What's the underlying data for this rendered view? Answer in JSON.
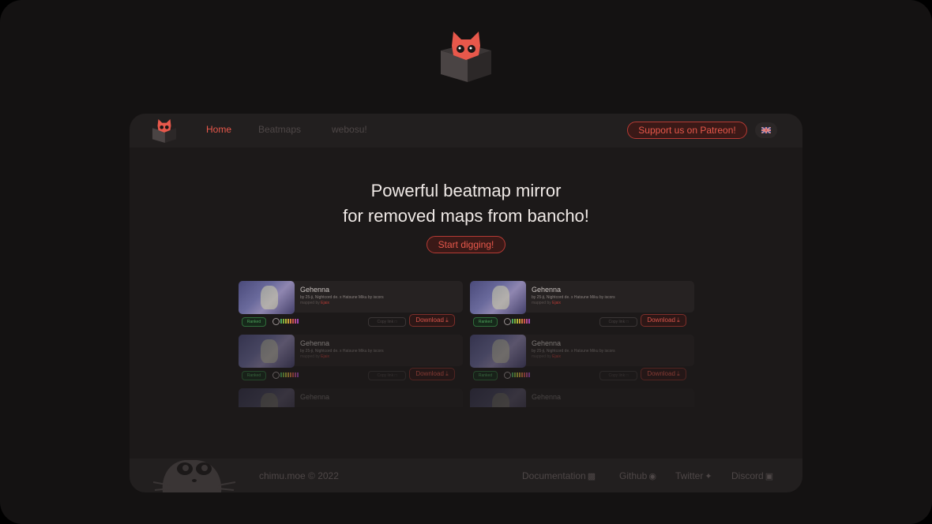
{
  "nav": {
    "links": [
      "Home",
      "Beatmaps",
      "webosu!"
    ],
    "patreon": "Support us on Patreon!"
  },
  "hero": {
    "line1": "Powerful beatmap mirror",
    "line2": "for removed maps from bancho!",
    "cta": "Start digging!"
  },
  "card": {
    "title": "Gehenna",
    "subtitle": "by 25-ji, Nightcord de. x Hatsune Miku by iscors",
    "mapped_by": "mapped by",
    "mapper": "Ejaix",
    "status": "Ranked",
    "copy": "Copy link",
    "download": "Download"
  },
  "footer": {
    "copyright": "chimu.moe © 2022",
    "links": [
      "Documentation",
      "Github",
      "Twitter",
      "Discord"
    ]
  },
  "colors": {
    "accent": "#e8584b",
    "background": "#141212",
    "panel": "#1c1919"
  },
  "icons": [
    "cat-box-logo",
    "uk-flag-icon",
    "download-icon",
    "copy-icon",
    "document-icon",
    "github-icon",
    "twitter-icon",
    "discord-icon"
  ]
}
